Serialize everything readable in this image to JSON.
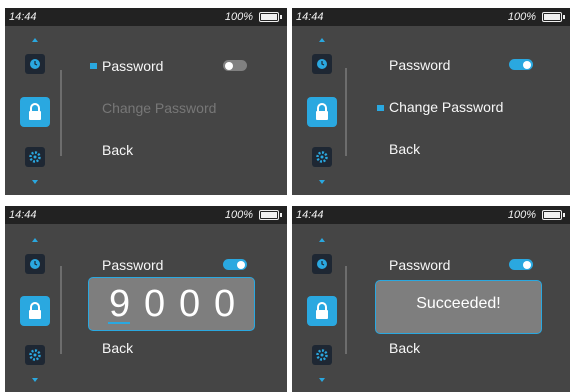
{
  "status": {
    "time": "14:44",
    "battery": "100%"
  },
  "menu": {
    "password": "Password",
    "change_password": "Change Password",
    "back": "Back"
  },
  "panels": [
    {
      "selected": "Password",
      "password_toggle": "off"
    },
    {
      "selected": "Change Password",
      "password_toggle": "on"
    },
    {
      "password_toggle": "on",
      "pin_digits": [
        "9",
        "0",
        "0",
        "0"
      ],
      "active_digit": 1
    },
    {
      "password_toggle": "on",
      "popup": "Succeeded!"
    }
  ],
  "colors": {
    "accent": "#2aa8e0",
    "screen_bg": "#454545",
    "status_bg": "#222222",
    "popup_bg": "#7e7e7e"
  },
  "icons": [
    "chevron-up-icon",
    "clock-icon",
    "lock-icon",
    "gear-icon",
    "chevron-down-icon",
    "battery-icon"
  ]
}
